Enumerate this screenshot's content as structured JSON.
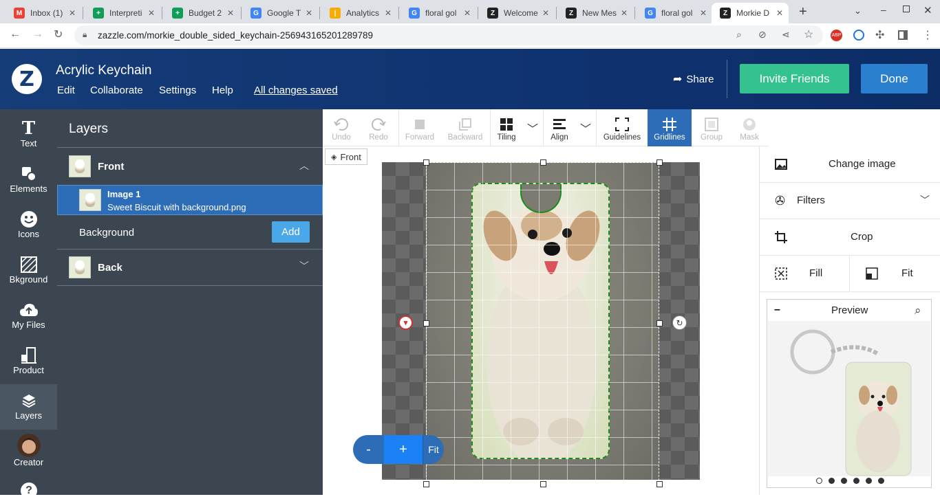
{
  "browser": {
    "tabs": [
      {
        "title": "Inbox (1)",
        "icon": "gmail-icon",
        "color": "#ea4335",
        "letter": "M"
      },
      {
        "title": "Interpreti",
        "icon": "sheets-icon",
        "color": "#0f9d58",
        "letter": "+"
      },
      {
        "title": "Budget 2",
        "icon": "sheets-icon",
        "color": "#0f9d58",
        "letter": "+"
      },
      {
        "title": "Google T",
        "icon": "translate-icon",
        "color": "#4285f4",
        "letter": "G"
      },
      {
        "title": "Analytics",
        "icon": "analytics-icon",
        "color": "#f9ab00",
        "letter": "|"
      },
      {
        "title": "floral gol",
        "icon": "google-icon",
        "color": "#4285f4",
        "letter": "G"
      },
      {
        "title": "Welcome",
        "icon": "zazzle-icon",
        "color": "#222222",
        "letter": "Z"
      },
      {
        "title": "New Mes",
        "icon": "zazzle-icon",
        "color": "#222222",
        "letter": "Z"
      },
      {
        "title": "floral gol",
        "icon": "google-icon",
        "color": "#4285f4",
        "letter": "G"
      },
      {
        "title": "Morkie D",
        "icon": "zazzle-icon",
        "color": "#222222",
        "letter": "Z"
      }
    ],
    "url": "zazzle.com/morkie_double_sided_keychain-256943165201289789"
  },
  "header": {
    "title": "Acrylic Keychain",
    "menu": [
      "Edit",
      "Collaborate",
      "Settings",
      "Help"
    ],
    "saved_status": "All changes saved",
    "share_label": "Share",
    "invite_label": "Invite Friends",
    "done_label": "Done"
  },
  "rail": {
    "items": [
      {
        "label": "Text",
        "icon": "text-icon"
      },
      {
        "label": "Elements",
        "icon": "elements-icon"
      },
      {
        "label": "Icons",
        "icon": "smiley-icon"
      },
      {
        "label": "Bkground",
        "icon": "background-icon"
      },
      {
        "label": "My Files",
        "icon": "cloud-upload-icon"
      },
      {
        "label": "Product",
        "icon": "product-icon"
      },
      {
        "label": "Layers",
        "icon": "layers-icon"
      },
      {
        "label": "Creator",
        "icon": "avatar"
      }
    ]
  },
  "layers": {
    "title": "Layers",
    "front_label": "Front",
    "image_title": "Image 1",
    "image_file": "Sweet Biscuit with background.png",
    "background_label": "Background",
    "add_label": "Add",
    "back_label": "Back"
  },
  "tools": {
    "undo": "Undo",
    "redo": "Redo",
    "forward": "Forward",
    "backward": "Backward",
    "tiling": "Tiling",
    "align": "Align",
    "guidelines": "Guidelines",
    "gridlines": "Gridlines",
    "group": "Group",
    "mask": "Mask"
  },
  "canvas": {
    "side_tag": "Front",
    "zoom_minus": "-",
    "zoom_plus": "+",
    "zoom_fit": "Fit"
  },
  "right_panel": {
    "change_image": "Change image",
    "filters": "Filters",
    "crop": "Crop",
    "fill": "Fill",
    "fit": "Fit",
    "preview_title": "Preview",
    "preview_minus": "–",
    "preview_pages": 6
  },
  "colors": {
    "header_bg": "#153d78",
    "invite": "#34c38f",
    "done": "#2b7fcf",
    "rail_bg": "#3c4650",
    "active_blue": "#2d6db7",
    "keychain_outline": "#1e8a1e"
  }
}
